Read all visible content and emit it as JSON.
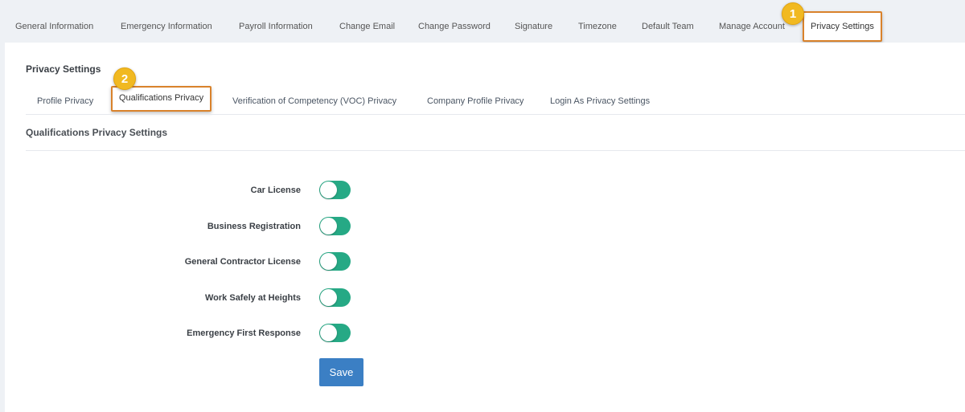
{
  "top_tabs": [
    {
      "label": "General Information"
    },
    {
      "label": "Emergency Information"
    },
    {
      "label": "Payroll Information"
    },
    {
      "label": "Change Email"
    },
    {
      "label": "Change Password"
    },
    {
      "label": "Signature"
    },
    {
      "label": "Timezone"
    },
    {
      "label": "Default Team"
    },
    {
      "label": "Manage Account"
    },
    {
      "label": "Privacy Settings"
    }
  ],
  "badges": {
    "one": "1",
    "two": "2"
  },
  "section_title": "Privacy Settings",
  "sub_tabs": [
    {
      "label": "Profile Privacy"
    },
    {
      "label": "Qualifications Privacy"
    },
    {
      "label": "Verification of Competency (VOC) Privacy"
    },
    {
      "label": "Company Profile Privacy"
    },
    {
      "label": "Login As Privacy Settings"
    }
  ],
  "settings_title": "Qualifications Privacy Settings",
  "rows": [
    {
      "label": "Car License"
    },
    {
      "label": "Business Registration"
    },
    {
      "label": "General Contractor License"
    },
    {
      "label": "Work Safely at Heights"
    },
    {
      "label": "Emergency First Response"
    }
  ],
  "save_label": "Save",
  "colors": {
    "accent": "#d9822b",
    "toggle": "#26a985",
    "button": "#3b7fc4",
    "badge": "#f1b921"
  }
}
